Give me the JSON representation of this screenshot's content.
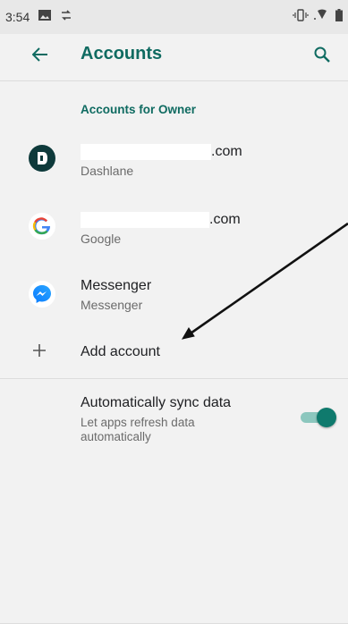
{
  "status_bar": {
    "time": "3:54",
    "left_icons": [
      "image-icon",
      "sync-icon"
    ],
    "right_icons": [
      "vibrate-icon",
      "wifi-icon",
      "battery-icon"
    ]
  },
  "app_bar": {
    "title": "Accounts",
    "back_icon": "back-arrow-icon",
    "search_icon": "search-icon"
  },
  "section_header": "Accounts for Owner",
  "accounts": [
    {
      "primary_suffix": ".com",
      "secondary": "Dashlane",
      "icon": "dashlane-icon"
    },
    {
      "primary_suffix": ".com",
      "secondary": "Google",
      "icon": "google-icon"
    },
    {
      "primary": "Messenger",
      "secondary": "Messenger",
      "icon": "messenger-icon"
    }
  ],
  "add_account": {
    "label": "Add account",
    "icon": "plus-icon"
  },
  "sync": {
    "title": "Automatically sync data",
    "subtitle": "Let apps refresh data automatically",
    "enabled": true
  },
  "colors": {
    "accent": "#0f6b61",
    "background": "#f2f2f2"
  }
}
